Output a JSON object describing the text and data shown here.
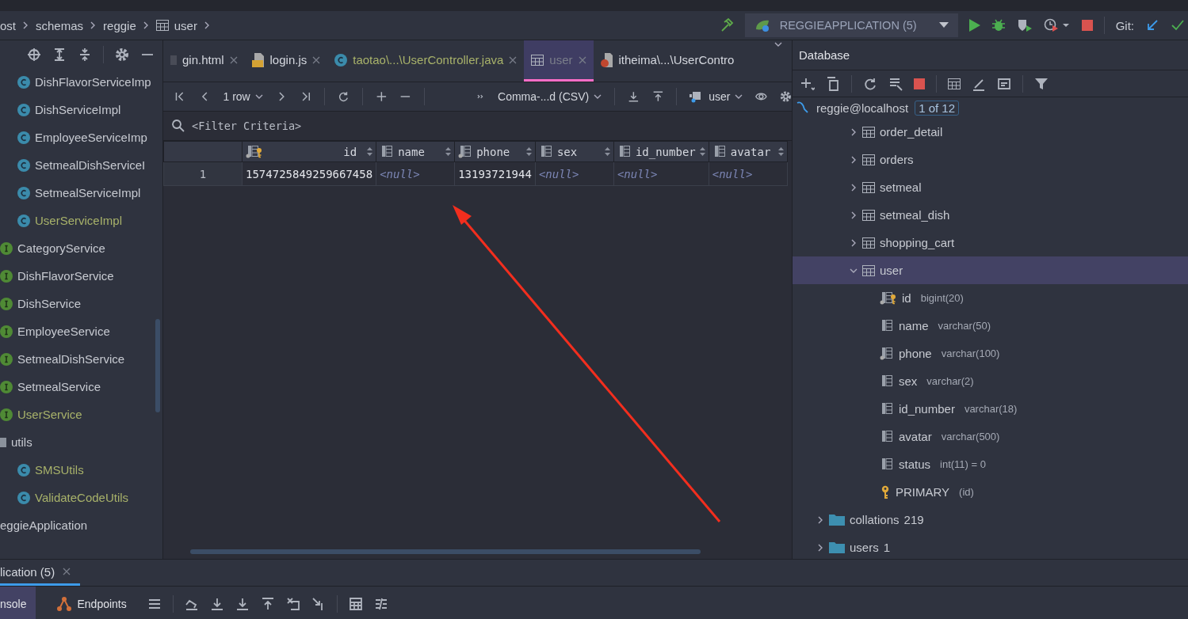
{
  "breadcrumb": [
    {
      "label": "ost",
      "kind": "text"
    },
    {
      "label": "schemas",
      "kind": "text"
    },
    {
      "label": "reggie",
      "kind": "text"
    },
    {
      "label": "user",
      "kind": "table"
    }
  ],
  "run_toolbar": {
    "configuration": "REGGIEAPPLICATION (5)",
    "git_label": "Git:"
  },
  "project_tree": [
    {
      "children": [
        {
          "label": "DishFlavorServiceImp",
          "kind": "class",
          "added": false
        },
        {
          "label": "DishServiceImpl",
          "kind": "class",
          "added": false
        },
        {
          "label": "EmployeeServiceImp",
          "kind": "class",
          "added": false
        },
        {
          "label": "SetmealDishServiceI",
          "kind": "class",
          "added": false
        },
        {
          "label": "SetmealServiceImpl",
          "kind": "class",
          "added": false
        },
        {
          "label": "UserServiceImpl",
          "kind": "class",
          "added": true
        }
      ]
    },
    {
      "label": "CategoryService",
      "kind": "interface",
      "added": false
    },
    {
      "label": "DishFlavorService",
      "kind": "interface",
      "added": false
    },
    {
      "label": "DishService",
      "kind": "interface",
      "added": false
    },
    {
      "label": "EmployeeService",
      "kind": "interface",
      "added": false
    },
    {
      "label": "SetmealDishService",
      "kind": "interface",
      "added": false
    },
    {
      "label": "SetmealService",
      "kind": "interface",
      "added": false
    },
    {
      "label": "UserService",
      "kind": "interface",
      "added": true
    },
    {
      "label": "utils",
      "kind": "package",
      "added": false,
      "children": [
        {
          "label": "SMSUtils",
          "kind": "class",
          "added": true
        },
        {
          "label": "ValidateCodeUtils",
          "kind": "class",
          "added": true
        }
      ]
    },
    {
      "label": "eggieApplication",
      "kind": "text",
      "added": false
    }
  ],
  "editor_tabs": [
    {
      "label": "gin.html",
      "kind": "html",
      "selected": false,
      "added": false
    },
    {
      "label": "login.js",
      "kind": "js",
      "selected": false,
      "added": false
    },
    {
      "label": "taotao\\...\\UserController.java",
      "kind": "class",
      "selected": false,
      "added": true
    },
    {
      "label": "user",
      "kind": "table",
      "selected": true,
      "added": false
    },
    {
      "label": "itheima\\...\\UserContro",
      "kind": "java-file",
      "selected": false,
      "added": false
    }
  ],
  "data_toolbar": {
    "rows": "1 row",
    "extractor": "Comma-...d (CSV)",
    "session": "user"
  },
  "filter": {
    "placeholder": "<Filter Criteria>"
  },
  "grid": {
    "columns": [
      {
        "label": "id",
        "kind": "key"
      },
      {
        "label": "name",
        "kind": "column"
      },
      {
        "label": "phone",
        "kind": "indexed"
      },
      {
        "label": "sex",
        "kind": "column"
      },
      {
        "label": "id_number",
        "kind": "column"
      },
      {
        "label": "avatar",
        "kind": "column"
      }
    ],
    "rows": [
      {
        "number": "1",
        "cells": [
          {
            "text": "1574725849259667458",
            "null": false
          },
          {
            "text": "<null>",
            "null": true
          },
          {
            "text": "13193721944",
            "null": false
          },
          {
            "text": "<null>",
            "null": true
          },
          {
            "text": "<null>",
            "null": true
          },
          {
            "text": "<null>",
            "null": true
          }
        ]
      }
    ]
  },
  "database": {
    "title": "Database",
    "connection": "reggie@localhost",
    "badge": "1 of 12",
    "tables": [
      {
        "label": "order_detail",
        "expanded": false,
        "selected": false
      },
      {
        "label": "orders",
        "expanded": false,
        "selected": false
      },
      {
        "label": "setmeal",
        "expanded": false,
        "selected": false
      },
      {
        "label": "setmeal_dish",
        "expanded": false,
        "selected": false
      },
      {
        "label": "shopping_cart",
        "expanded": false,
        "selected": false
      },
      {
        "label": "user",
        "expanded": true,
        "selected": true,
        "children": [
          {
            "label": "id",
            "type": "bigint(20)",
            "kind": "key"
          },
          {
            "label": "name",
            "type": "varchar(50)",
            "kind": "column"
          },
          {
            "label": "phone",
            "type": "varchar(100)",
            "kind": "indexed"
          },
          {
            "label": "sex",
            "type": "varchar(2)",
            "kind": "column"
          },
          {
            "label": "id_number",
            "type": "varchar(18)",
            "kind": "column"
          },
          {
            "label": "avatar",
            "type": "varchar(500)",
            "kind": "column"
          },
          {
            "label": "status",
            "type": "int(11) = 0",
            "kind": "column"
          },
          {
            "label": "PRIMARY",
            "type": "(id)",
            "kind": "primary"
          }
        ]
      }
    ],
    "folders": [
      {
        "label": "collations",
        "count": "219",
        "expanded": false
      },
      {
        "label": "users",
        "count": "1",
        "expanded": false
      }
    ]
  },
  "bottom": {
    "tabs": [
      {
        "label": "lication (5)",
        "selected": true
      }
    ],
    "tool_tabs": [
      {
        "label": "nsole",
        "kind": "console",
        "selected": true
      },
      {
        "label": "Endpoints",
        "kind": "endpoints",
        "selected": false
      }
    ]
  }
}
